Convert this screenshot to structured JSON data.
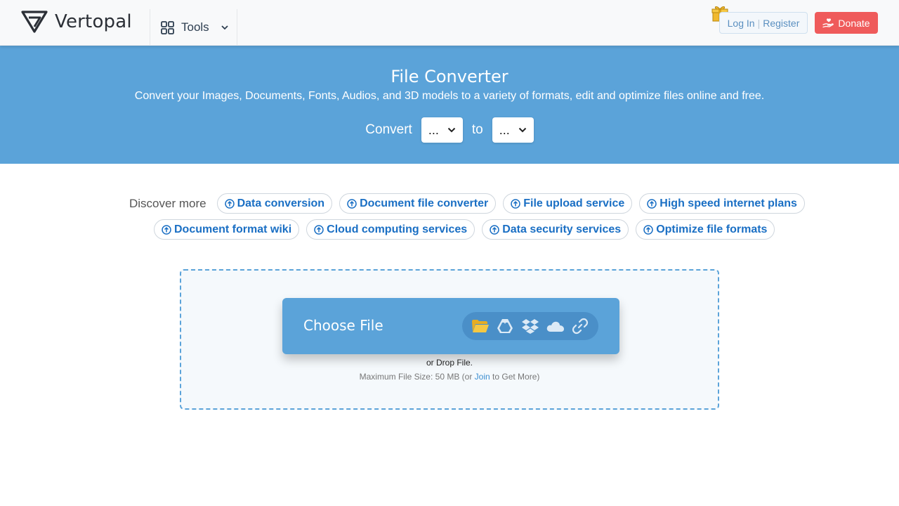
{
  "header": {
    "brand": "Vertopal",
    "tools_label": "Tools",
    "login_label": "Log In",
    "separator": "|",
    "register_label": "Register",
    "donate_label": "Donate"
  },
  "hero": {
    "title": "File Converter",
    "subtitle": "Convert your Images, Documents, Fonts, Audios, and 3D models to a variety of formats, edit and optimize files online and free.",
    "convert_label": "Convert",
    "from_value": "...",
    "to_label": "to",
    "to_value": "..."
  },
  "discover": {
    "label": "Discover more",
    "row1": [
      "Data conversion",
      "Document file converter",
      "File upload service",
      "High speed internet plans"
    ],
    "row2": [
      "Document format wiki",
      "Cloud computing services",
      "Data security services",
      "Optimize file formats"
    ]
  },
  "upload": {
    "choose_label": "Choose File",
    "sources": [
      "folder-icon",
      "google-drive-icon",
      "dropbox-icon",
      "onedrive-icon",
      "link-icon"
    ],
    "drop_text": "or Drop File.",
    "max_prefix": "Maximum File Size: 50 MB (or ",
    "join_label": "Join",
    "max_suffix": " to Get More)"
  },
  "colors": {
    "accent": "#5ba3d9",
    "donate": "#ef5b5b",
    "chip_text": "#1a6fc4",
    "folder": "#f5c842"
  }
}
